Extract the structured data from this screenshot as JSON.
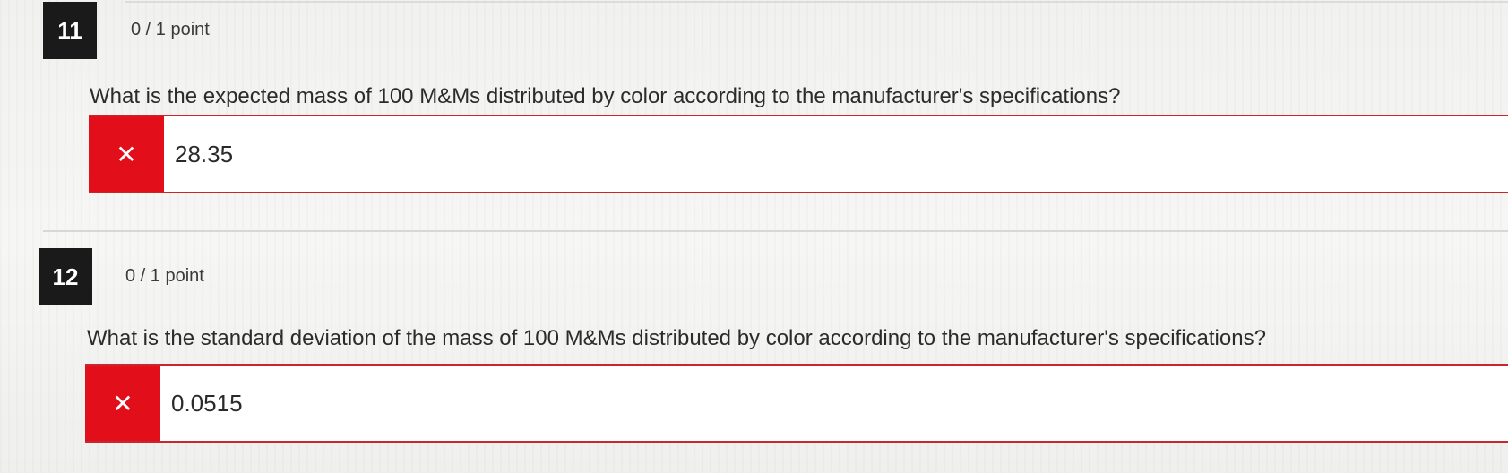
{
  "questions": [
    {
      "number": "11",
      "points": "0 / 1 point",
      "text": "What is the expected mass of 100 M&Ms distributed by color according to the manufacturer's specifications?",
      "answer": "28.35",
      "status_icon": "x-icon",
      "status_glyph": "✕",
      "status_color": "#e20f1a"
    },
    {
      "number": "12",
      "points": "0 / 1 point",
      "text": "What is the standard deviation of the mass of 100 M&Ms distributed by color according to the manufacturer's specifications?",
      "answer": "0.0515",
      "status_icon": "x-icon",
      "status_glyph": "✕",
      "status_color": "#e20f1a"
    }
  ]
}
